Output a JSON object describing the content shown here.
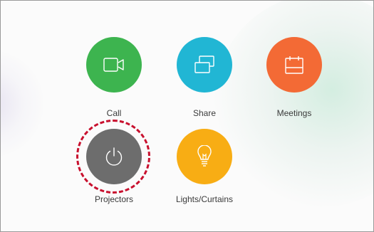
{
  "tiles": [
    {
      "id": "call",
      "label": "Call",
      "color": "#3db44f",
      "icon": "video-camera-icon"
    },
    {
      "id": "share",
      "label": "Share",
      "color": "#21b6d4",
      "icon": "share-screens-icon"
    },
    {
      "id": "meetings",
      "label": "Meetings",
      "color": "#f36a35",
      "icon": "calendar-icon"
    },
    {
      "id": "projectors",
      "label": "Projectors",
      "color": "#6d6d6d",
      "icon": "power-icon",
      "highlighted": true
    },
    {
      "id": "lights",
      "label": "Lights/Curtains",
      "color": "#f8ad14",
      "icon": "lightbulb-icon"
    }
  ],
  "highlight_color": "#c8102e"
}
